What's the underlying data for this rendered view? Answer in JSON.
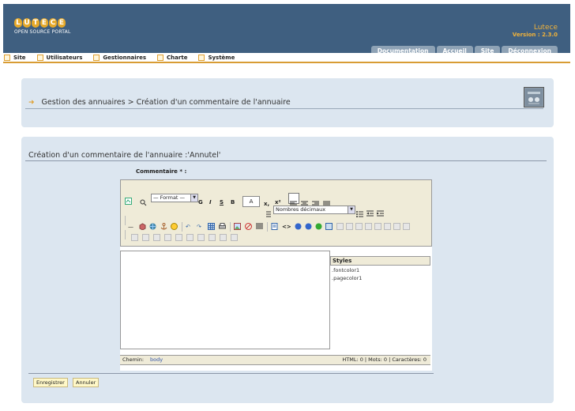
{
  "logo": {
    "letters": [
      "L",
      "U",
      "T",
      "E",
      "C",
      "E"
    ],
    "subtitle": "OPEN SOURCE PORTAL"
  },
  "app": {
    "name": "Lutece",
    "version": "Version : 2.3.0"
  },
  "top_tabs": [
    "Documentation",
    "Accueil",
    "Site",
    "Déconnexion"
  ],
  "menu": [
    "Site",
    "Utilisateurs",
    "Gestionnaires",
    "Charte",
    "Système"
  ],
  "breadcrumb": "Gestion des annuaires  > Création d'un commentaire de l'annuaire",
  "form": {
    "title": "Création d'un commentaire de l'annuaire :'Annutel'",
    "comment_label": "Commentaire * :"
  },
  "editor": {
    "format_value": "— Format —",
    "font_size_value": "A",
    "numbering_value": "Nombres décimaux",
    "styles_header": "Styles",
    "styles": [
      ".fontcolor1",
      ".pagecolor1"
    ],
    "path_label": "Chemin:",
    "path_value": "body",
    "stats": "HTML: 0 | Mots: 0 | Caractères: 0"
  },
  "buttons": {
    "save": "Enregistrer",
    "cancel": "Annuler"
  },
  "colors": {
    "header": "#3f5f80",
    "accent": "#e0a030",
    "panel": "#dce6f0",
    "tab": "#8ea2b5"
  }
}
